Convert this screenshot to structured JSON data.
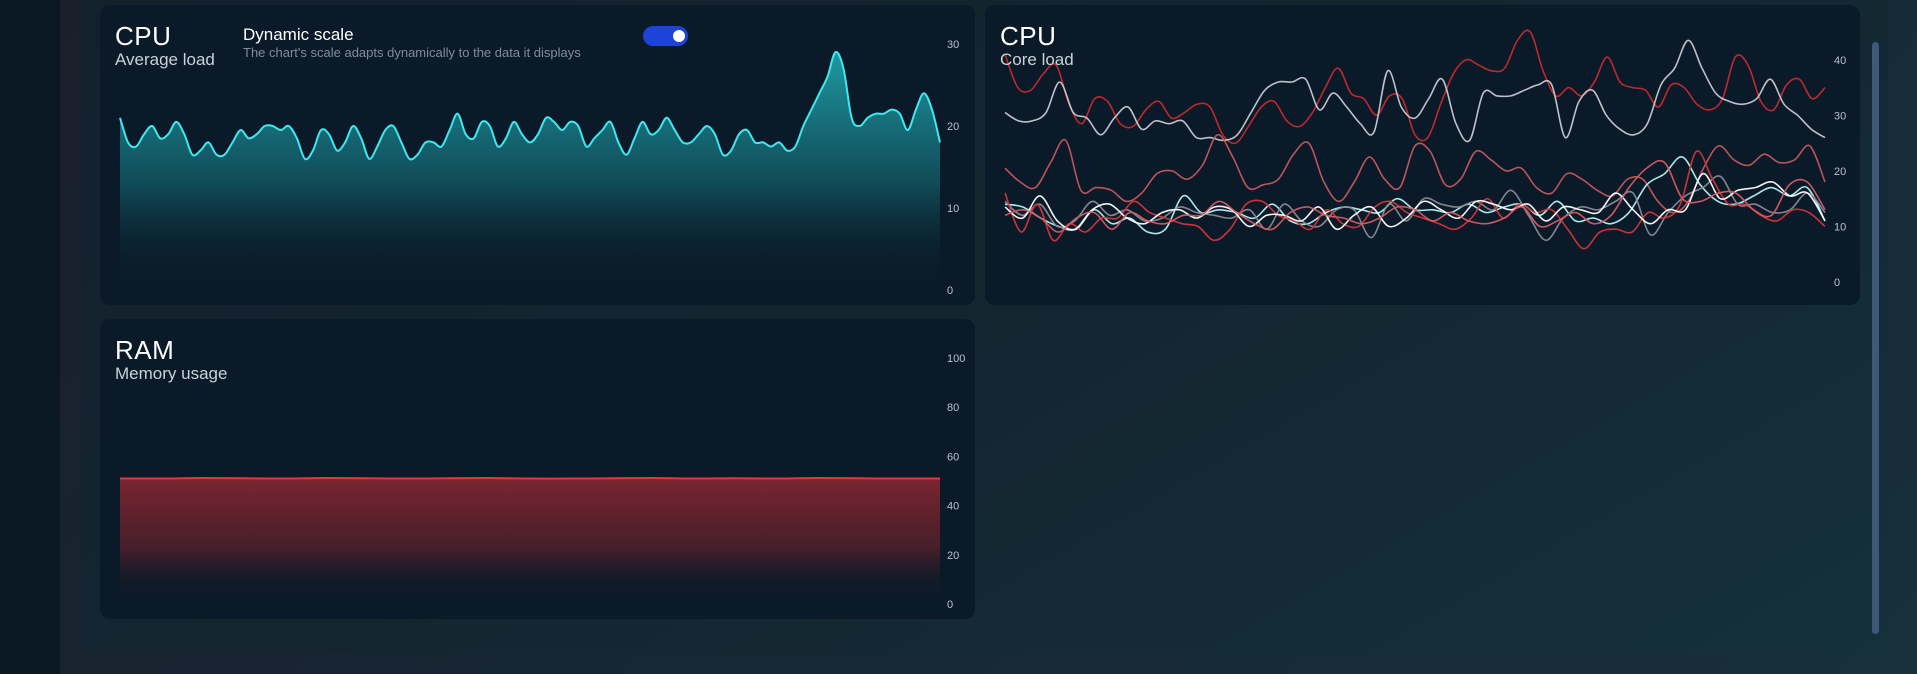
{
  "cards": {
    "cpu_average": {
      "title": "CPU",
      "subtitle": "Average load",
      "dynamic_scale": {
        "label": "Dynamic scale",
        "description": "The chart's scale adapts dynamically to the data it displays",
        "enabled": true
      }
    },
    "cpu_core": {
      "title": "CPU",
      "subtitle": "Core load"
    },
    "ram": {
      "title": "RAM",
      "subtitle": "Memory usage"
    }
  },
  "colors": {
    "cpu_average_line": "#3ee8ef",
    "ram_line": "#e0393e",
    "toggle_on": "#1d43d8",
    "core_series": [
      "#c62a2e",
      "#c9c9d1",
      "#c4585e",
      "#b3f4f6",
      "#8a8b95",
      "#d4353a",
      "#ffffff",
      "#d45c64"
    ]
  },
  "chart_data": [
    {
      "id": "cpu_average",
      "type": "area",
      "ylim": [
        0,
        30
      ],
      "yticks": [
        "0",
        "10",
        "20",
        "30"
      ],
      "grid": false,
      "series": [
        {
          "values": [
            21,
            18,
            17.5,
            19,
            20,
            18.5,
            19,
            20.5,
            19,
            16.5,
            17,
            18,
            16.5,
            16.5,
            18,
            19.5,
            18.5,
            19,
            20,
            20,
            19.5,
            20,
            18.5,
            16,
            17,
            19.5,
            19,
            17,
            18,
            20,
            18.5,
            16,
            17.5,
            19.5,
            20,
            18,
            16,
            16.5,
            18,
            18,
            17.5,
            19.5,
            21.5,
            19,
            18.5,
            20.5,
            20,
            17.5,
            18.5,
            20.5,
            19,
            18,
            19,
            21,
            20.5,
            19.5,
            20.5,
            20,
            17.5,
            18.5,
            19.5,
            20.5,
            18,
            16.5,
            18.5,
            20.5,
            19,
            19.5,
            21,
            19.5,
            18,
            18,
            19,
            20,
            19,
            16.5,
            17,
            19,
            19.5,
            18,
            18,
            17.5,
            18,
            17,
            17.5,
            20,
            22,
            24,
            26,
            29,
            27,
            21,
            20,
            21,
            21.5,
            21.5,
            22,
            21.5,
            19.5,
            22,
            24,
            22,
            18
          ]
        }
      ]
    },
    {
      "id": "cpu_core",
      "type": "line",
      "ylim": [
        0,
        45
      ],
      "yticks": [
        "0",
        "10",
        "20",
        "30",
        "40"
      ],
      "grid": false,
      "series": [
        {
          "values": [
            41,
            35,
            34.5,
            37.5,
            39,
            32,
            28.5,
            33,
            32.5,
            28.5,
            28,
            31,
            32.5,
            29.5,
            30.5,
            32,
            31.5,
            26.5,
            25,
            28,
            31.5,
            32.5,
            29,
            28,
            30.5,
            35,
            38.5,
            34,
            33,
            30,
            33.5,
            33,
            26.5,
            26,
            32,
            37.5,
            40,
            39,
            38,
            38.5,
            43.5,
            45,
            38,
            33.5,
            35,
            33.5,
            36,
            40.5,
            36,
            35,
            34.5,
            31.5,
            35.5,
            35,
            32,
            31,
            33,
            40.5,
            39,
            32.5,
            31,
            35.5,
            36.5,
            33,
            35
          ]
        },
        {
          "values": [
            30.5,
            29,
            29,
            30.5,
            36,
            30.5,
            29.5,
            26.5,
            29.5,
            31.5,
            27.5,
            29,
            28.5,
            29,
            26,
            26,
            25.5,
            26.5,
            30.5,
            34.5,
            36,
            36,
            36.5,
            31,
            34,
            31.5,
            28.5,
            27,
            38,
            31.5,
            29.5,
            33,
            36.5,
            28.5,
            25.5,
            34,
            33.5,
            33.5,
            34.5,
            35.5,
            35.5,
            26,
            32.5,
            34.5,
            30,
            27.5,
            26.5,
            28.5,
            35.5,
            38.5,
            43.5,
            38.5,
            34,
            32.5,
            32,
            33,
            36.5,
            32,
            30,
            27.5,
            26
          ]
        },
        {
          "values": [
            20.5,
            18,
            17,
            21.5,
            25.5,
            16.5,
            17,
            16.5,
            14.5,
            16,
            19.5,
            20,
            18.5,
            21,
            26.5,
            22.5,
            17,
            17.5,
            18.5,
            23,
            25,
            18,
            14.5,
            18,
            22.5,
            18.5,
            17,
            24.5,
            23.5,
            17.5,
            18.5,
            23.5,
            22,
            20,
            20.5,
            17,
            16,
            19.5,
            18.5,
            16.5,
            15.5,
            18.5,
            18.5,
            14.5,
            12.5,
            14.5,
            20.5,
            24.5,
            22,
            21,
            23,
            21.5,
            22,
            24.5,
            18
          ]
        },
        {
          "values": [
            14,
            13.5,
            11.5,
            10,
            9.5,
            13,
            10.5,
            11.5,
            9,
            9.5,
            15.5,
            12.5,
            13,
            12.5,
            11.5,
            14,
            11,
            10.5,
            12.5,
            13.5,
            13,
            12.5,
            15,
            13,
            13,
            12.5,
            14,
            12.5,
            13.5,
            14,
            12,
            14.5,
            11,
            11.5,
            10.5,
            12.5,
            17.5,
            19.5,
            22.5,
            17.5,
            14.5,
            14,
            15.5,
            17,
            15.5,
            17,
            11
          ]
        },
        {
          "values": [
            14.5,
            12,
            14,
            10,
            11,
            14.5,
            12,
            13,
            11,
            11.5,
            13.5,
            12.5,
            12,
            11.5,
            13,
            9.5,
            14,
            11,
            10,
            13,
            13,
            8,
            14,
            11,
            15,
            14,
            13.5,
            14.5,
            13,
            16.5,
            12,
            7.5,
            11.5,
            13.5,
            13,
            14.5,
            16,
            8.5,
            12.5,
            15.5,
            17,
            19,
            14,
            14,
            12.5,
            13,
            16,
            12.5
          ]
        },
        {
          "values": [
            16,
            9,
            14,
            7.5,
            10.5,
            9,
            11.5,
            11.5,
            14.5,
            12.5,
            11.5,
            10.5,
            10,
            7.5,
            9.5,
            14,
            14.5,
            12,
            11,
            9.5,
            13,
            10.5,
            10,
            13.5,
            14.5,
            12.5,
            11.5,
            10.5,
            9.5,
            11.5,
            15,
            11.5,
            14,
            12.5,
            13,
            9.5,
            6,
            9,
            9.5,
            9,
            12.5,
            11.5,
            14,
            23.5,
            18.5,
            14,
            14,
            12,
            11,
            13,
            12.5,
            10
          ]
        },
        {
          "values": [
            13.5,
            11.5,
            15.5,
            11,
            9.5,
            13,
            14,
            11.5,
            10.5,
            12.5,
            13,
            11.5,
            13.5,
            13,
            10,
            12,
            12,
            11,
            13.5,
            9.5,
            12,
            13.5,
            10,
            11.5,
            14.5,
            13,
            11.5,
            14.5,
            14,
            13,
            14,
            11,
            13.5,
            13,
            12.5,
            16,
            13,
            10.5,
            13,
            13,
            19.5,
            15,
            16.5,
            17,
            18,
            15.5,
            16,
            11
          ]
        },
        {
          "values": [
            12,
            13,
            11.5,
            9,
            11.5,
            12.5,
            9.5,
            12.5,
            11,
            10.5,
            12,
            12,
            14.5,
            12.5,
            10.5,
            9.5,
            12.5,
            13.5,
            12,
            11.5,
            10.5,
            11.5,
            13.5,
            13,
            11,
            12.5,
            11,
            10.5,
            11.5,
            13.5,
            10,
            11,
            12.5,
            10.5,
            12,
            17,
            20.5,
            21.5,
            15,
            14.5,
            16,
            16,
            13,
            12,
            17.5,
            18,
            13
          ]
        }
      ]
    },
    {
      "id": "ram",
      "type": "area",
      "ylim": [
        0,
        100
      ],
      "yticks": [
        "0",
        "20",
        "40",
        "60",
        "80",
        "100"
      ],
      "grid": false,
      "series": [
        {
          "values": [
            51,
            51,
            51.2,
            51.1,
            51,
            51.2,
            51.1,
            51,
            51.1,
            51.2,
            51,
            51,
            51.1,
            51.2,
            51,
            51.1,
            51,
            51.2,
            51.1,
            51,
            51
          ]
        }
      ]
    }
  ]
}
